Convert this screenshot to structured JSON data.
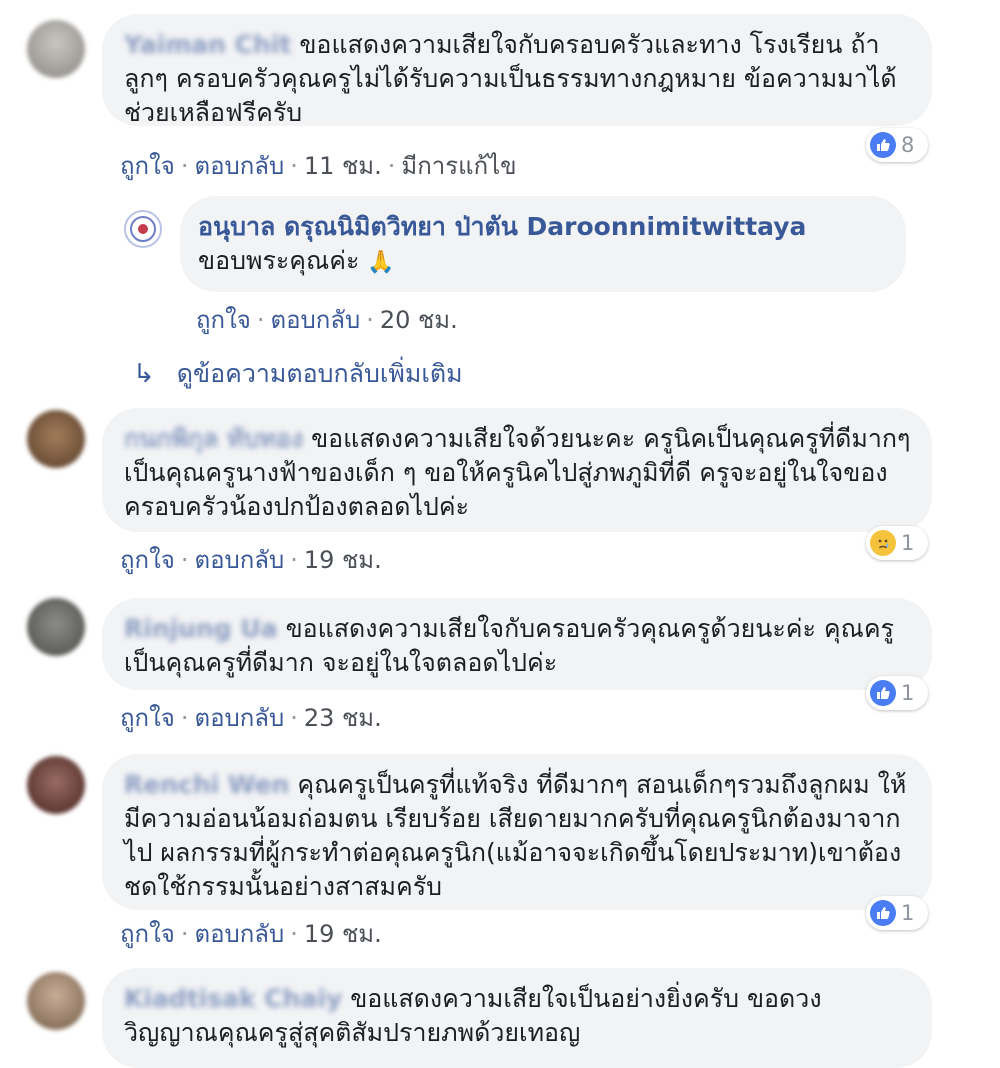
{
  "action_labels": {
    "like": "ถูกใจ",
    "reply": "ตอบกลับ",
    "sep": "·"
  },
  "comments": [
    {
      "author": "Yaiman Chit",
      "text": "ขอแสดงความเสียใจกับครอบครัวและทาง โรงเรียน ถ้าลูกๆ ครอบครัวคุณครูไม่ได้รับความเป็นธรรมทางกฎหมาย ข้อความมาได้ ช่วยเหลือฟรีครับ",
      "time": "11 ชม.",
      "edited": "มีการแก้ไข",
      "reaction": {
        "type": "like",
        "count": "8"
      }
    },
    {
      "author": "กนกพิกุล ทับทอง",
      "text": "ขอแสดงความเสียใจด้วยนะคะ ครูนิคเป็นคุณครูที่ดีมากๆ เป็นคุณครูนางฟ้าของเด็ก ๆ ขอให้ครูนิคไปสู่ภพภูมิที่ดี ครูจะอยู่ในใจของครอบครัวน้องปกป้องตลอดไปค่ะ",
      "time": "19 ชม.",
      "reaction": {
        "type": "sad",
        "count": "1"
      }
    },
    {
      "author": "Rinjung Ua",
      "text": "ขอแสดงความเสียใจกับครอบครัวคุณครูด้วยนะค่ะ คุณครูเป็นคุณครูที่ดีมาก จะอยู่ในใจตลอดไปค่ะ",
      "time": "23 ชม.",
      "reaction": {
        "type": "like",
        "count": "1"
      }
    },
    {
      "author": "Renchi Wen",
      "text": "คุณครูเป็นครูที่แท้จริง ที่ดีมากๆ สอนเด็กๆรวมถึงลูกผม ให้มีความอ่อนน้อมถ่อมตน เรียบร้อย เสียดายมากครับที่คุณครูนิกต้องมาจากไป ผลกรรมที่ผู้กระทำต่อคุณครูนิก(แม้อาจจะเกิดขึ้นโดยประมาท)เขาต้องชดใช้กรรมนั้นอย่างสาสมครับ",
      "time": "19 ชม.",
      "reaction": {
        "type": "like",
        "count": "1"
      }
    },
    {
      "author": "Kiadtisak Chaiy",
      "text": "ขอแสดงความเสียใจเป็นอย่างยิ่งครับ ขอดวงวิญญาณคุณครูสู่สุคติสัมปรายภพด้วยเทอญ"
    }
  ],
  "reply": {
    "author": "อนุบาล ดรุณนิมิตวิทยา ป่าตัน Daroonnimitwittaya",
    "text": "ขอบพระคุณค่ะ",
    "emoji": "🙏",
    "time": "20 ชม."
  },
  "more_replies_label": "ดูข้อความตอบกลับเพิ่มเติม",
  "colors": {
    "link": "#385898",
    "bubble": "#f2f3f5",
    "like": "#4a7cf3",
    "sad": "#f5c33b"
  }
}
